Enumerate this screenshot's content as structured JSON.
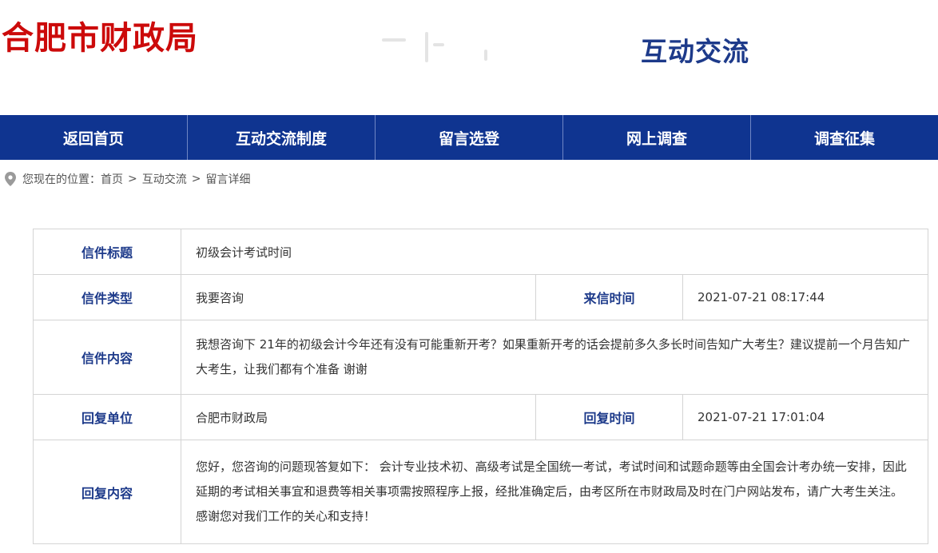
{
  "header": {
    "site_name": "合肥市财政局",
    "section_title": "互动交流"
  },
  "nav": {
    "items": [
      "返回首页",
      "互动交流制度",
      "留言选登",
      "网上调查",
      "调查征集"
    ]
  },
  "breadcrumb": {
    "prefix": "您现在的位置：",
    "items": [
      "首页",
      "互动交流",
      "留言详细"
    ],
    "separator": ">",
    "icon": "location-pin-icon"
  },
  "letter": {
    "title_label": "信件标题",
    "title_value": "初级会计考试时间",
    "type_label": "信件类型",
    "type_value": "我要咨询",
    "time_label": "来信时间",
    "time_value": "2021-07-21 08:17:44",
    "content_label": "信件内容",
    "content_value": "我想咨询下 21年的初级会计今年还有没有可能重新开考？如果重新开考的话会提前多久多长时间告知广大考生？建议提前一个月告知广大考生，让我们都有个准备 谢谢"
  },
  "reply": {
    "unit_label": "回复单位",
    "unit_value": "合肥市财政局",
    "time_label": "回复时间",
    "time_value": "2021-07-21 17:01:04",
    "content_label": "回复内容",
    "content_value": "您好，您咨询的问题现答复如下： 会计专业技术初、高级考试是全国统一考试，考试时间和试题命题等由全国会计考办统一安排，因此延期的考试相关事宜和退费等相关事项需按照程序上报，经批准确定后，由考区所在市财政局及时在门户网站发布，请广大考生关注。 感谢您对我们工作的关心和支持！"
  },
  "colors": {
    "logo_red": "#cc0a0a",
    "nav_blue": "#0f3490",
    "label_blue": "#1d3a8a",
    "border_gray": "#d4d4d4"
  }
}
